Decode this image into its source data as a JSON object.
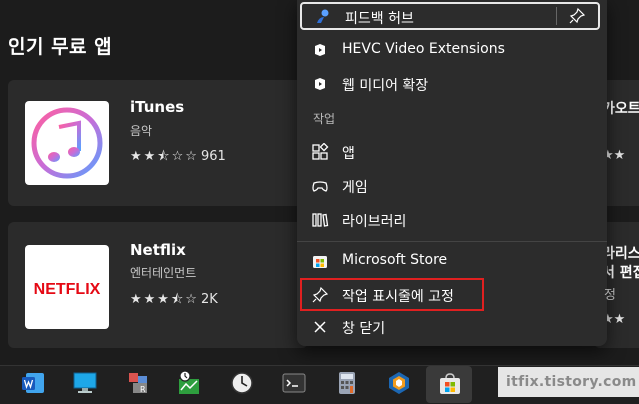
{
  "store": {
    "section_title": "인기 무료 앱",
    "apps": [
      {
        "name": "iTunes",
        "category": "음악",
        "stars": "★★⯪☆☆",
        "rating_count": "961"
      },
      {
        "name": "Netflix",
        "category": "엔터테인먼트",
        "stars": "★★★⯪☆",
        "rating_count": "2K"
      }
    ],
    "right_partial": [
      {
        "title": "카오트",
        "sub": "!",
        "stars": "★★"
      },
      {
        "title": "라리스",
        "title2": "서 편집",
        "stars": "★★"
      }
    ],
    "netflix_logo": "NETFLIX"
  },
  "menu": {
    "feedback_label": "피드백 허브",
    "recent": [
      "HEVC Video Extensions",
      "웹 미디어 확장"
    ],
    "section_header": "작업",
    "tasks": [
      "앱",
      "게임",
      "라이브러리"
    ],
    "app_name": "Microsoft Store",
    "pin_label": "작업 표시줄에 고정",
    "close_label": "창 닫기",
    "pin_hint": "정"
  },
  "watermark": "itfix.tistory.com",
  "colors": {
    "highlight": "#e02020",
    "netflix_red": "#e50914",
    "store_accent": "#f25022"
  }
}
